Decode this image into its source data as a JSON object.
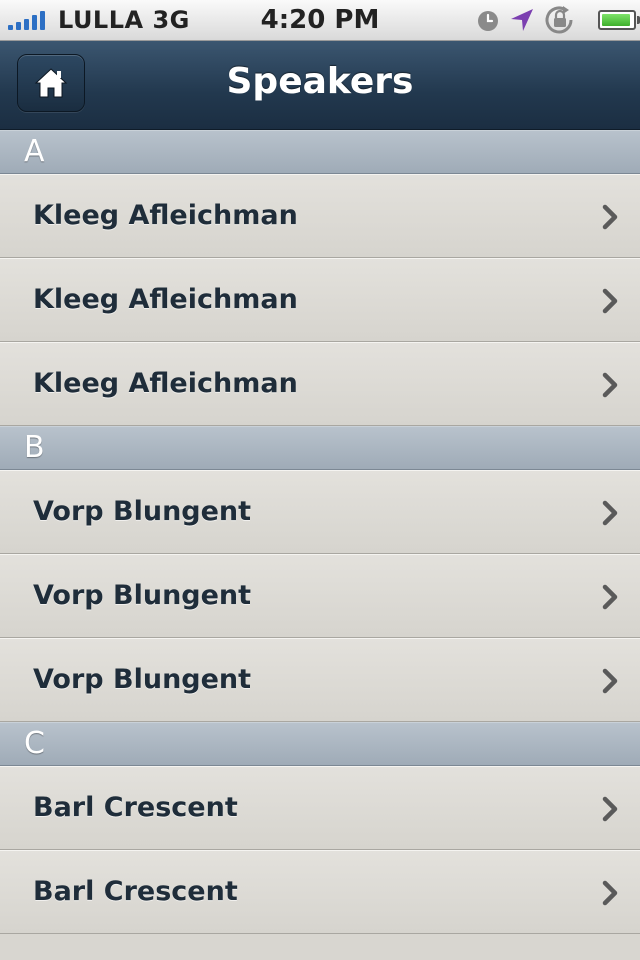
{
  "status_bar": {
    "carrier": "LULLA 3G",
    "time": "4:20 PM",
    "icons": [
      "signal-icon",
      "alarm-clock-icon",
      "location-arrow-icon",
      "orientation-lock-icon",
      "battery-icon"
    ]
  },
  "nav": {
    "title": "Speakers",
    "home_icon": "home-icon"
  },
  "sections": [
    {
      "letter": "A",
      "items": [
        "Kleeg Afleichman",
        "Kleeg Afleichman",
        "Kleeg Afleichman"
      ]
    },
    {
      "letter": "B",
      "items": [
        "Vorp Blungent",
        "Vorp Blungent",
        "Vorp Blungent"
      ]
    },
    {
      "letter": "C",
      "items": [
        "Barl Crescent",
        "Barl Crescent"
      ]
    }
  ],
  "colors": {
    "nav_bar": "#22384e",
    "section_header": "#a9b4bf",
    "row_text": "#1f2d3a",
    "location_arrow": "#7b3fb0",
    "battery_fill": "#4cc236"
  }
}
